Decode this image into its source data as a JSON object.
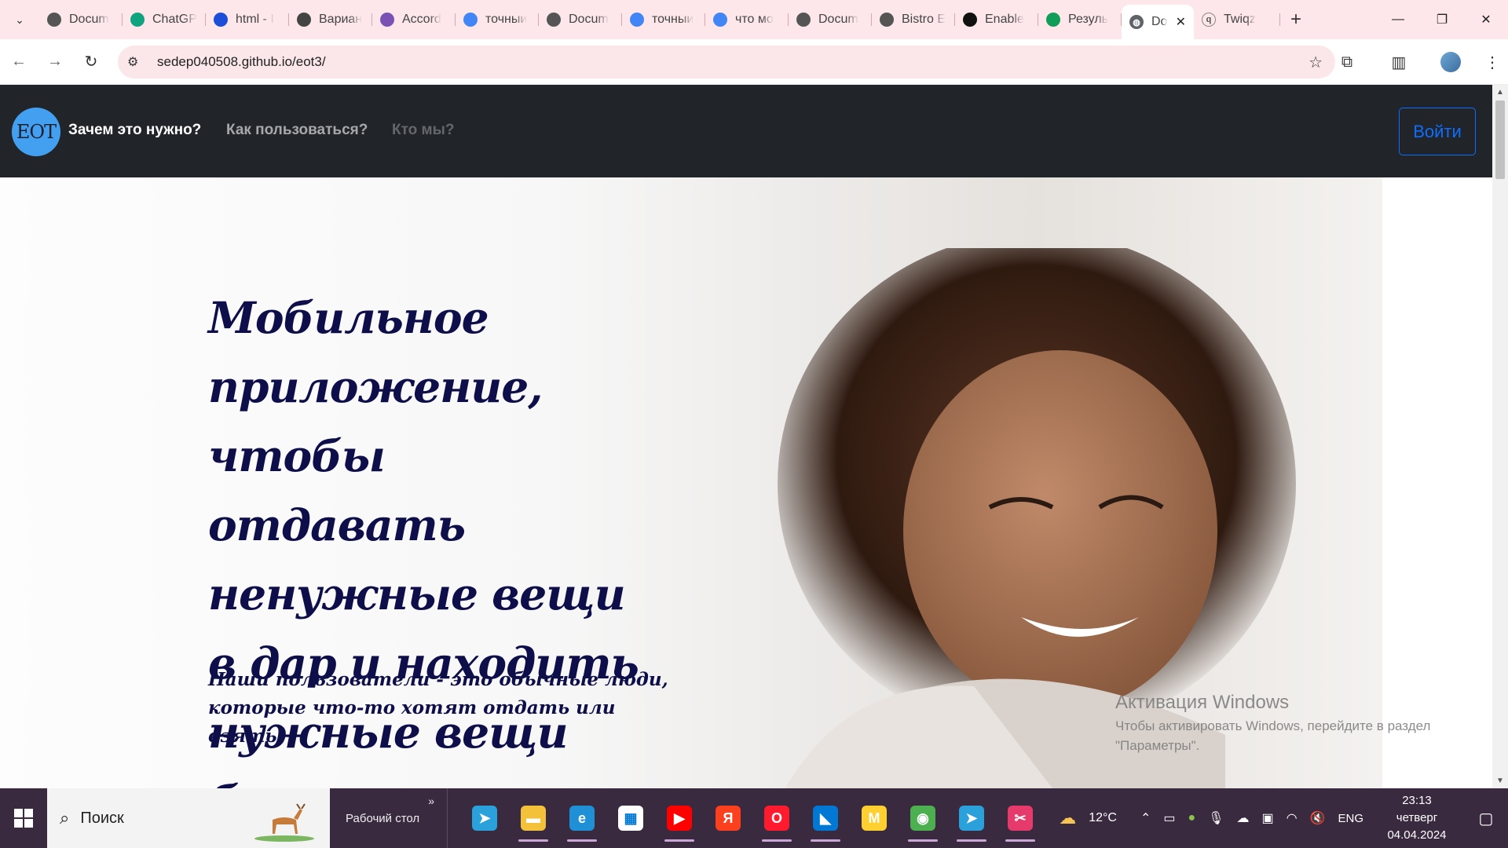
{
  "browser": {
    "tabs": [
      {
        "label": "Docum",
        "icon": "globe-icon",
        "color": "#555"
      },
      {
        "label": "ChatGP",
        "icon": "chatgpt-icon",
        "color": "#10a37f"
      },
      {
        "label": "html - I",
        "icon": "stackoverflow-icon",
        "color": "#1d4ed8"
      },
      {
        "label": "Вариан",
        "icon": "doc-icon",
        "color": "#444"
      },
      {
        "label": "Accord",
        "icon": "bootstrap-icon",
        "color": "#7952b3"
      },
      {
        "label": "точныи",
        "icon": "google-icon",
        "color": "#4285f4"
      },
      {
        "label": "Docum",
        "icon": "globe-icon",
        "color": "#555"
      },
      {
        "label": "точныи",
        "icon": "google-icon",
        "color": "#4285f4"
      },
      {
        "label": "что мо",
        "icon": "google-icon",
        "color": "#4285f4"
      },
      {
        "label": "Docum",
        "icon": "globe-icon",
        "color": "#555"
      },
      {
        "label": "Bistro E",
        "icon": "globe-icon",
        "color": "#555"
      },
      {
        "label": "Enable",
        "icon": "github-icon",
        "color": "#111"
      },
      {
        "label": "Резуль",
        "icon": "sheets-icon",
        "color": "#0f9d58"
      }
    ],
    "active_tab": {
      "label": "Do",
      "icon": "globe-icon"
    },
    "extra_tab": {
      "label": "Twiqz",
      "icon": "twiqz-icon"
    },
    "url": "sedep040508.github.io/eot3/"
  },
  "site": {
    "logo_text": "EOT",
    "nav": [
      "Зачем это нужно?",
      "Как пользоваться?",
      "Кто мы?"
    ],
    "login_label": "Войти",
    "hero_title": "Мобильное приложение, чтобы отдавать ненужные вещи в дар и находить нужные вещи бесплатно.",
    "hero_subtitle": "Наши пользователи - это обычные люди, которые что-то хотят отдать или взять."
  },
  "watermark": {
    "title": "Активация Windows",
    "line1": "Чтобы активировать Windows, перейдите в раздел",
    "line2": "\"Параметры\"."
  },
  "taskbar": {
    "search_placeholder": "Поиск",
    "desktop_label": "Рабочий стол",
    "weather": "12°C",
    "lang": "ENG",
    "time": "23:13",
    "day": "четверг",
    "date": "04.04.2024",
    "apps": [
      {
        "name": "telegram-icon",
        "color": "#2aa1da",
        "glyph": "➤",
        "running": false
      },
      {
        "name": "file-explorer-icon",
        "color": "#f3c13a",
        "glyph": "▬",
        "running": true
      },
      {
        "name": "edge-icon",
        "color": "#1f8fd6",
        "glyph": "e",
        "running": true
      },
      {
        "name": "ms-store-icon",
        "color": "#ffffff",
        "glyph": "▦",
        "running": false
      },
      {
        "name": "youtube-icon",
        "color": "#ff0000",
        "glyph": "▶",
        "running": true
      },
      {
        "name": "yandex-browser-icon",
        "color": "#fc3f1d",
        "glyph": "Я",
        "running": false
      },
      {
        "name": "opera-icon",
        "color": "#ff1b2d",
        "glyph": "O",
        "running": true
      },
      {
        "name": "vscode-icon",
        "color": "#0078d4",
        "glyph": "◣",
        "running": true
      },
      {
        "name": "miro-icon",
        "color": "#ffd02f",
        "glyph": "M",
        "running": false
      },
      {
        "name": "chrome-icon",
        "color": "#4caf50",
        "glyph": "◉",
        "running": true
      },
      {
        "name": "telegram-badge-icon",
        "color": "#2aa1da",
        "glyph": "➤",
        "running": true
      },
      {
        "name": "snipping-tool-icon",
        "color": "#e53a6b",
        "glyph": "✂",
        "running": true
      }
    ]
  }
}
